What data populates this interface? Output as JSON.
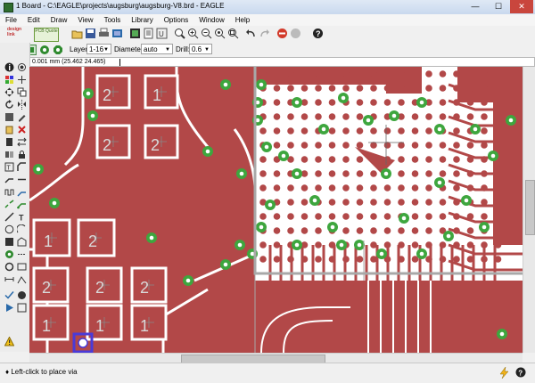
{
  "window": {
    "title": "1 Board - C:\\EAGLE\\projects\\augsburg\\augsburg-V8.brd - EAGLE",
    "minimize_glyph": "—",
    "maximize_glyph": "☐",
    "close_glyph": "✕"
  },
  "menu": [
    "File",
    "Edit",
    "Draw",
    "View",
    "Tools",
    "Library",
    "Options",
    "Window",
    "Help"
  ],
  "toolbar": {
    "logo_text": "design link",
    "pcb_text": "PCB Quote",
    "icons": [
      "open-icon",
      "save-icon",
      "print-icon",
      "cam-icon",
      "board-schematic-icon",
      "script-icon",
      "run-ulp-icon",
      "zoom-fit-icon",
      "zoom-in-icon",
      "zoom-out-icon",
      "zoom-redraw-icon",
      "zoom-area-icon",
      "undo-icon",
      "redo-icon",
      "stop-icon",
      "go-icon",
      "help-icon"
    ]
  },
  "param_bar": {
    "layer_label": "Layer:",
    "layer_value": "1-16",
    "diameter_label": "Diameter:",
    "diameter_value": "auto",
    "drill_label": "Drill:",
    "drill_value": "0.6"
  },
  "command": {
    "coordinate": "0.001 mm (25.462 24.465)",
    "input_value": ""
  },
  "pads": {
    "top": [
      "2",
      "1",
      "2",
      "2"
    ],
    "middle": [
      "1",
      "2"
    ],
    "bottom_labels": [
      "2",
      "2",
      "2"
    ],
    "bottom_row": [
      "1",
      "1",
      "1"
    ]
  },
  "status": {
    "message": "Left-click to place via"
  },
  "colors": {
    "copper": "#b24848",
    "via_ring": "#3ea63e",
    "grid_gray": "#a8a8a8",
    "selection": "#4a3ad8"
  }
}
